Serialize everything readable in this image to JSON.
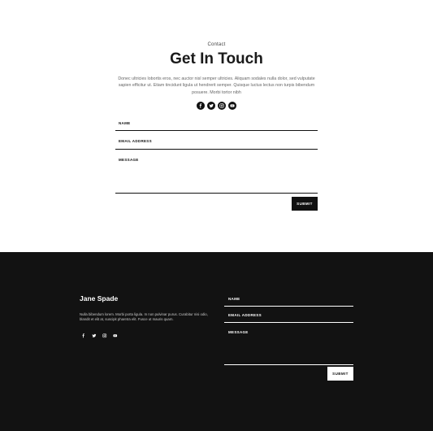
{
  "contact": {
    "eyebrow": "Contact",
    "title": "Get In Touch",
    "intro": "Donec ultricies lobortis eros, nec auctor nisl semper ultricies. Aliquam sodales nulla dolor, sed vulputate sapien efficitur ut. Etiam tincidunt ligula ut hendrerit semper. Quisque luctus lectus non turpis bibendum posuere. Morbi tortor nibh",
    "social_icons": [
      "facebook-icon",
      "twitter-icon",
      "instagram-icon",
      "youtube-icon"
    ],
    "form": {
      "name_label": "NAME",
      "email_label": "EMAIL ADDRESS",
      "message_label": "MESSAGE",
      "submit_label": "SUBMIT"
    }
  },
  "footer": {
    "brand": "Jane Spade",
    "text": "Nulla bibendum lorem. Morbi porta ligula. In non pulvinar purus. Curabitur nisi odio, blandit et elit at, suscipit pharetra elit. Fusce ut mauris quam.",
    "social_icons": [
      "facebook-icon",
      "twitter-icon",
      "instagram-icon",
      "youtube-icon"
    ],
    "form": {
      "name_label": "NAME",
      "email_label": "EMAIL ADDRESS",
      "message_label": "MESSAGE",
      "submit_label": "SUBMIT"
    }
  },
  "colors": {
    "dark": "#121212",
    "light": "#ffffff",
    "accent": "#111111"
  }
}
